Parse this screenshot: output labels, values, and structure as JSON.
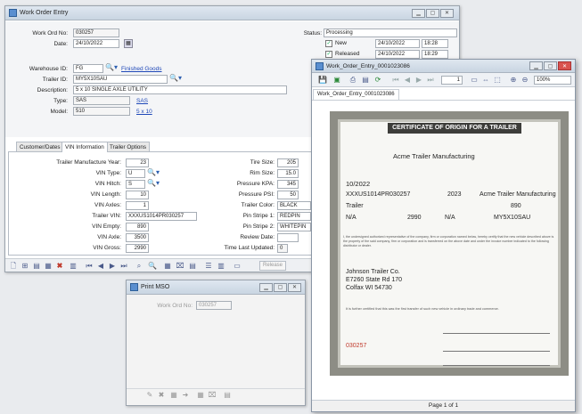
{
  "work_order_window": {
    "title": "Work Order Entry",
    "work_ord_no_label": "Work Ord No:",
    "work_ord_no": "030257",
    "date_label": "Date:",
    "date": "24/10/2022",
    "status_label": "Status:",
    "status": "Processing",
    "status_rows": [
      {
        "label": "New",
        "date": "24/10/2022",
        "time": "18:28"
      },
      {
        "label": "Released",
        "date": "24/10/2022",
        "time": "18:29"
      }
    ],
    "warehouse_label": "Warehouse ID:",
    "warehouse_id": "FG",
    "warehouse_link": "Finished Goods",
    "trailer_label": "Trailer ID:",
    "trailer_id": "MY5X10SAU",
    "description_label": "Description:",
    "description": "5 x 10 SINGLE AXLE UTILITY",
    "type_label": "Type:",
    "type": "SAS",
    "type_link": "SAS",
    "model_label": "Model:",
    "model": "510",
    "model_link": "5 x 10",
    "tabs": [
      "Customer/Dates",
      "VIN Information",
      "Trailer Options"
    ],
    "left_fields": [
      {
        "label": "Trailer Manufacture Year:",
        "value": "23"
      },
      {
        "label": "VIN Type:",
        "value": "U"
      },
      {
        "label": "VIN Hitch:",
        "value": "S"
      },
      {
        "label": "VIN Length:",
        "value": "10"
      },
      {
        "label": "VIN Axles:",
        "value": "1"
      },
      {
        "label": "Trailer VIN:",
        "value": "XXXUS1014PR030257"
      },
      {
        "label": "VIN Empty:",
        "value": "890"
      },
      {
        "label": "VIN Axle:",
        "value": "3500"
      },
      {
        "label": "VIN Gross:",
        "value": "2990"
      }
    ],
    "right_fields": [
      {
        "label": "Tire Size:",
        "value": "205"
      },
      {
        "label": "Rim Size:",
        "value": "15.0"
      },
      {
        "label": "Pressure KPA:",
        "value": "345"
      },
      {
        "label": "Pressure PSI:",
        "value": "50"
      },
      {
        "label": "Trailer Color:",
        "value": "BLACK"
      },
      {
        "label": "Pin Stripe 1:",
        "value": "REDPIN"
      },
      {
        "label": "Pin Stripe 2:",
        "value": "WHITEPIN"
      },
      {
        "label": "Review Date:",
        "value": ""
      },
      {
        "label": "Time Last Updated:",
        "value": "0"
      }
    ],
    "release_button": "Release"
  },
  "print_window": {
    "title": "Print MSO",
    "work_ord_label": "Work Ord No:",
    "work_ord_no": "030257"
  },
  "report_window": {
    "title": "Work_Order_Entry_0001023086",
    "tab": "Work_Order_Entry_0001023086",
    "page_number": "1",
    "zoom": "100%",
    "footer": "Page 1 of 1"
  },
  "certificate": {
    "title": "CERTIFICATE OF ORIGIN FOR A TRAILER",
    "manufacturer": "Acme Trailer Manufacturing",
    "date": "10/2022",
    "vin": "XXXUS1014PR030257",
    "year": "2023",
    "maker": "Acme Trailer Manufacturing",
    "body_type": "Trailer",
    "shipping_weight": "890",
    "col1": "N/A",
    "col2": "2990",
    "col3": "N/A",
    "model": "MY5X10SAU",
    "para1": "I, the undersigned authorized representative of the company, firm or corporation named below, hereby certify that the new vehicle described above is the property of the said company, firm or corporation and is transferred on the above date and under the invoice number indicated to the following distributor or dealer.",
    "dealer_name": "Johnson Trailer Co.",
    "dealer_addr1": "E7260 State Rd 170",
    "dealer_addr2": "Colfax WI 54730",
    "para2": "It is further certified that this was the first transfer of such new vehicle in ordinary trade and commerce.",
    "serial": "030257"
  },
  "colors": {
    "cert_title_bg": "#3d3d3a",
    "serial_red": "#c0392b",
    "link": "#1f48b8"
  }
}
